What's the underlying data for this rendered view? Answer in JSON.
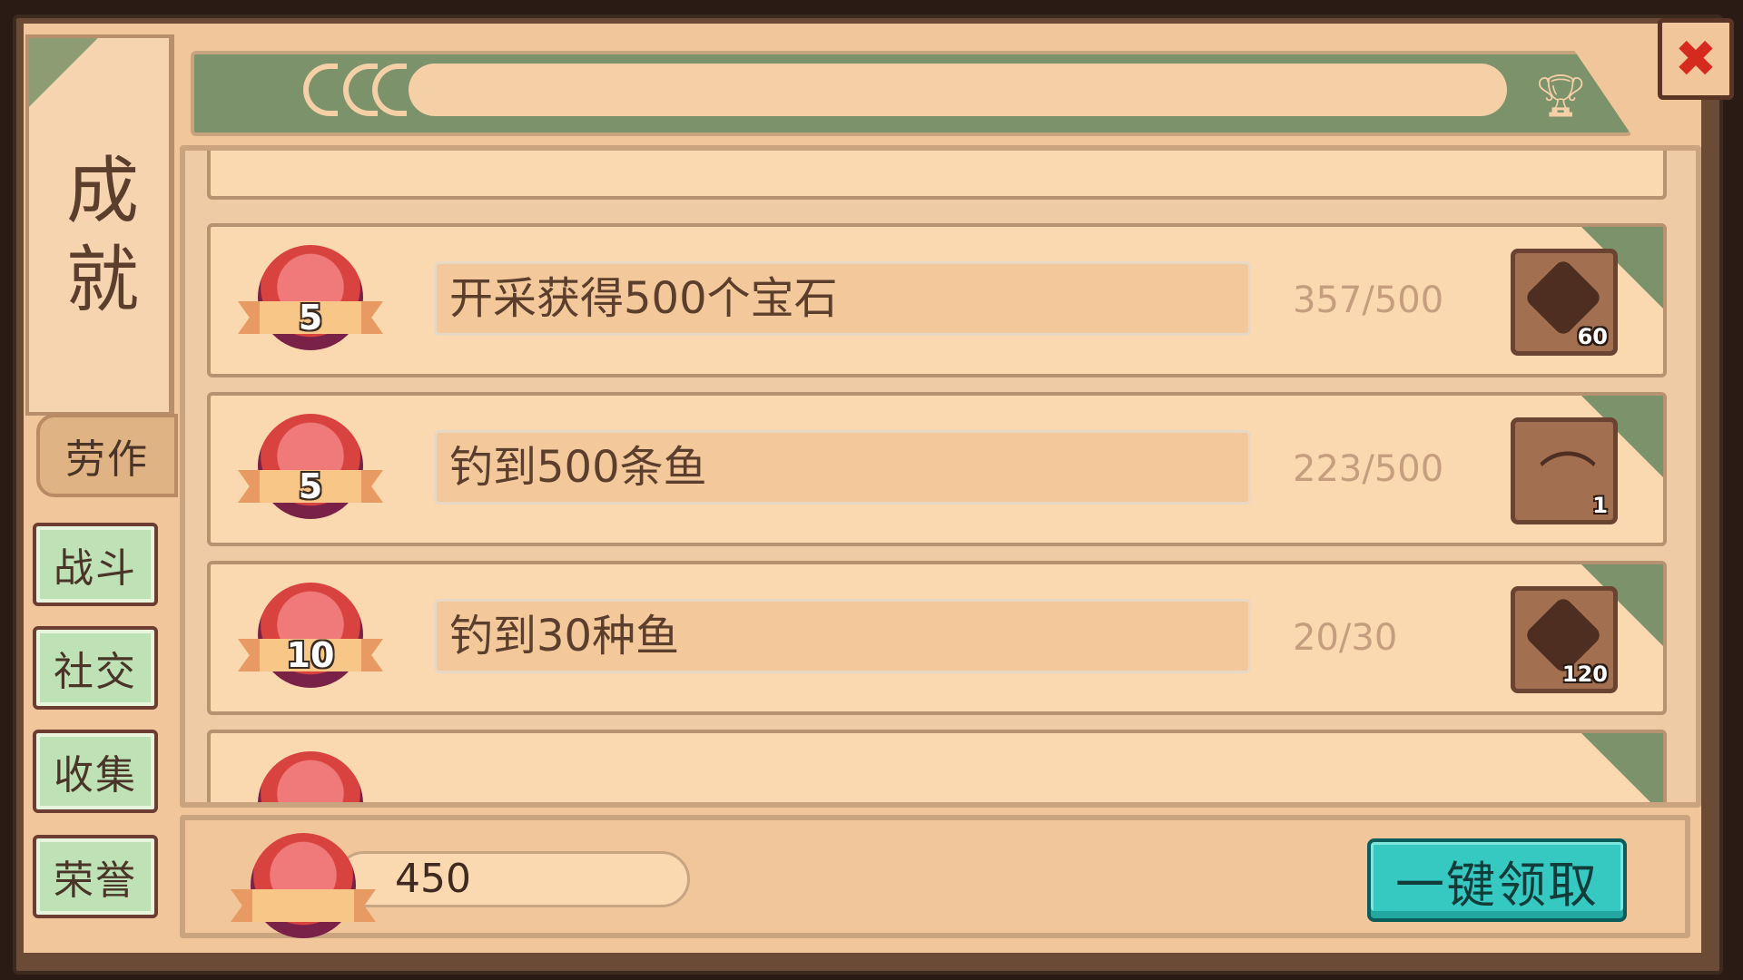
{
  "panel": {
    "title": "成就",
    "close_icon": "✖"
  },
  "tabs": [
    {
      "label": "劳作",
      "active": true
    },
    {
      "label": "战斗",
      "active": false
    },
    {
      "label": "社交",
      "active": false
    },
    {
      "label": "收集",
      "active": false
    },
    {
      "label": "荣誉",
      "active": false
    }
  ],
  "achievements": [
    {
      "medal_value": "5",
      "name": "开采获得500个宝石",
      "progress": "357/500",
      "reward_icon": "gem-icon",
      "reward_qty": "60"
    },
    {
      "medal_value": "5",
      "name": "钓到500条鱼",
      "progress": "223/500",
      "reward_icon": "fishing-rod-icon",
      "reward_qty": "1"
    },
    {
      "medal_value": "10",
      "name": "钓到30种鱼",
      "progress": "20/30",
      "reward_icon": "gem-icon",
      "reward_qty": "120"
    }
  ],
  "footer": {
    "total_points": "450",
    "claim_all_label": "一键领取"
  },
  "colors": {
    "accent_green": "#7c926a",
    "claim_button": "#35c9c2",
    "close_red": "#d52b1e"
  }
}
